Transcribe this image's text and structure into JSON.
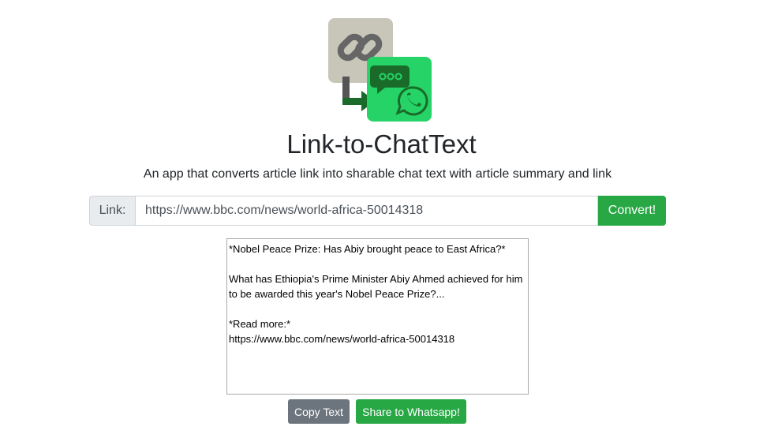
{
  "app": {
    "title": "Link-to-ChatText",
    "subtitle": "An app that converts article link into sharable chat text with article summary and link"
  },
  "form": {
    "link_label": "Link:",
    "link_value": "https://www.bbc.com/news/world-africa-50014318",
    "convert_label": "Convert!"
  },
  "output": {
    "text": "*Nobel Peace Prize: Has Abiy brought peace to East Africa?*\n\nWhat has Ethiopia's Prime Minister Abiy Ahmed achieved for him to be awarded this year's Nobel Peace Prize?...\n\n*Read more:*\nhttps://www.bbc.com/news/world-africa-50014318"
  },
  "actions": {
    "copy_label": "Copy Text",
    "share_label": "Share to Whatsapp!"
  },
  "colors": {
    "primary_green": "#28a745",
    "secondary_gray": "#6c757d",
    "logo_link_bg": "#c8c5b9",
    "logo_chat_bg": "#25d366"
  },
  "icons": {
    "logo": "link-to-whatsapp-logo-icon"
  }
}
